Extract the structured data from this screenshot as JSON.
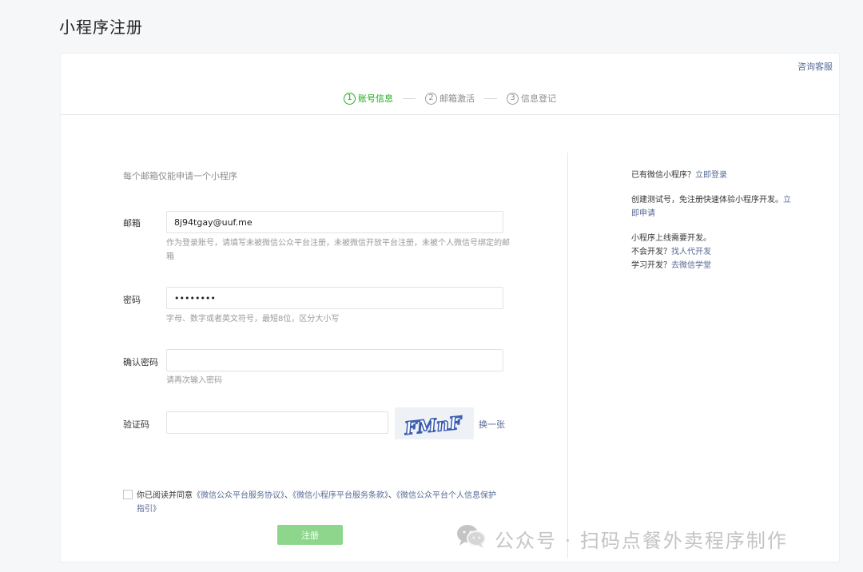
{
  "page": {
    "title": "小程序注册"
  },
  "header": {
    "support_link": "咨询客服",
    "steps": [
      {
        "num": "1",
        "label": "账号信息",
        "active": true
      },
      {
        "num": "2",
        "label": "邮箱激活",
        "active": false
      },
      {
        "num": "3",
        "label": "信息登记",
        "active": false
      }
    ]
  },
  "form": {
    "note": "每个邮箱仅能申请一个小程序",
    "email": {
      "label": "邮箱",
      "value": "8j94tgay@uuf.me",
      "hint": "作为登录账号，请填写未被微信公众平台注册，未被微信开放平台注册，未被个人微信号绑定的邮箱"
    },
    "password": {
      "label": "密码",
      "value": "••••••••",
      "hint": "字母、数字或者英文符号，最短8位，区分大小写"
    },
    "confirm_password": {
      "label": "确认密码",
      "value": "",
      "hint": "请再次输入密码"
    },
    "captcha": {
      "label": "验证码",
      "value": "",
      "image_text": "FMnF",
      "refresh": "换一张"
    },
    "agreement": {
      "checked": false,
      "prefix": "你已阅读并同意",
      "link1": "《微信公众平台服务协议》",
      "sep1": "、",
      "link2": "《微信小程序平台服务条款》",
      "sep2": "、",
      "link3": "《微信公众平台个人信息保护指引》"
    },
    "submit": "注册"
  },
  "side": {
    "login_prefix": "已有微信小程序？",
    "login_link": "立即登录",
    "test_text": "创建测试号，免注册快速体验小程序开发。",
    "test_link": "立即申请",
    "dev_line": "小程序上线需要开发。",
    "outsource_prefix": "不会开发？",
    "outsource_link": "找人代开发",
    "learn_prefix": "学习开发？",
    "learn_link": "去微信学堂"
  },
  "watermark": {
    "text": "公众号 · 扫码点餐外卖程序制作"
  },
  "colors": {
    "accent_green": "#1aad19",
    "button_disabled_green": "#8dd68c",
    "link_blue": "#576b95"
  }
}
